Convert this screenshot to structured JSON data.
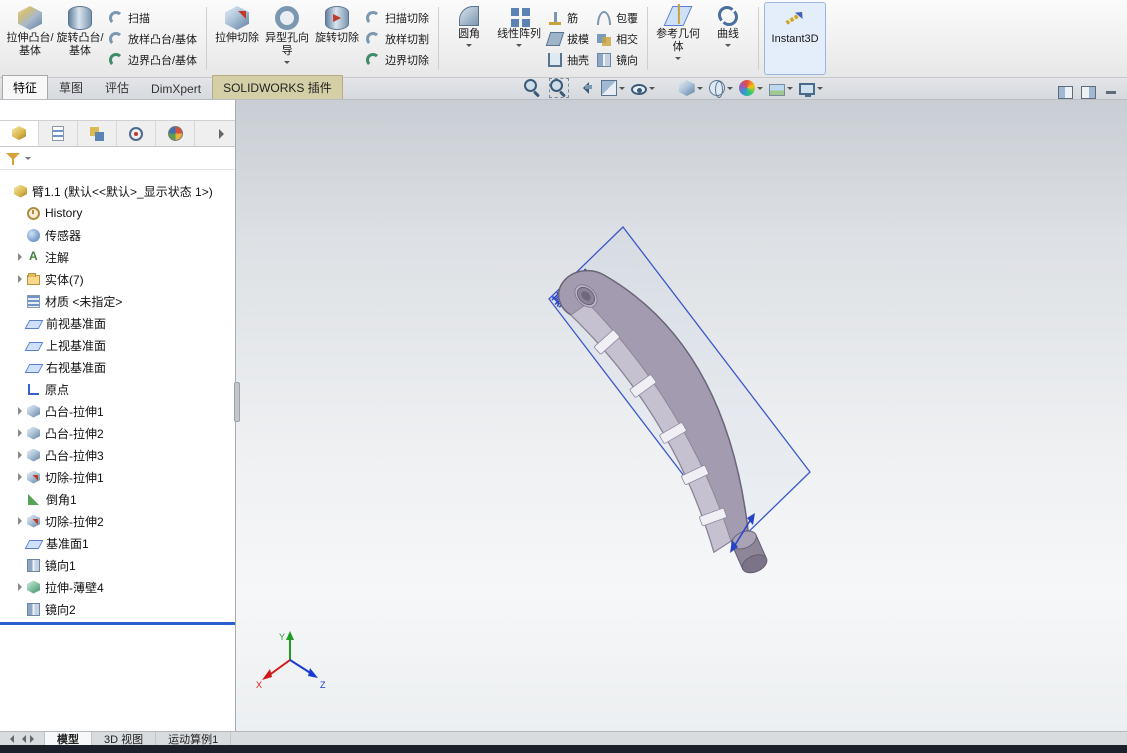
{
  "ribbon": {
    "extrude_boss": "拉伸凸台/基体",
    "revolve_boss": "旋转凸台/基体",
    "sweep": "扫描",
    "loft": "放样凸台/基体",
    "boundary": "边界凸台/基体",
    "extrude_cut": "拉伸切除",
    "hole_wizard": "异型孔向导",
    "revolve_cut": "旋转切除",
    "sweep_cut": "扫描切除",
    "loft_cut": "放样切割",
    "boundary_cut": "边界切除",
    "fillet": "圆角",
    "linear_pattern": "线性阵列",
    "rib": "筋",
    "draft": "拔模",
    "shell": "抽壳",
    "wrap": "包覆",
    "intersect": "相交",
    "mirror": "镜向",
    "reference_geometry": "参考几何体",
    "curves": "曲线",
    "instant3d": "Instant3D"
  },
  "command_tabs": {
    "features": "特征",
    "sketch": "草图",
    "evaluate": "评估",
    "dimxpert": "DimXpert",
    "addins": "SOLIDWORKS 插件"
  },
  "tree": {
    "items": [
      {
        "id": "root",
        "label": "臂1.1 (默认<<默认>_显示状态 1>)",
        "icon": "part",
        "indent": 0,
        "arrow": false
      },
      {
        "id": "history",
        "label": "History",
        "icon": "history",
        "indent": 1,
        "arrow": false
      },
      {
        "id": "sensors",
        "label": "传感器",
        "icon": "sensors",
        "indent": 1,
        "arrow": false
      },
      {
        "id": "annotations",
        "label": "注解",
        "icon": "annotations",
        "indent": 1,
        "arrow": true
      },
      {
        "id": "solid-bodies",
        "label": "实体(7)",
        "icon": "bodies",
        "indent": 1,
        "arrow": true
      },
      {
        "id": "material",
        "label": "材质 <未指定>",
        "icon": "material",
        "indent": 1,
        "arrow": false
      },
      {
        "id": "front-plane",
        "label": "前视基准面",
        "icon": "plane",
        "indent": 1,
        "arrow": false
      },
      {
        "id": "top-plane",
        "label": "上视基准面",
        "icon": "plane",
        "indent": 1,
        "arrow": false
      },
      {
        "id": "right-plane",
        "label": "右视基准面",
        "icon": "plane",
        "indent": 1,
        "arrow": false
      },
      {
        "id": "origin",
        "label": "原点",
        "icon": "origin",
        "indent": 1,
        "arrow": false
      },
      {
        "id": "boss-extrude1",
        "label": "凸台-拉伸1",
        "icon": "boss-extrude",
        "indent": 1,
        "arrow": true
      },
      {
        "id": "boss-extrude2",
        "label": "凸台-拉伸2",
        "icon": "boss-extrude",
        "indent": 1,
        "arrow": true
      },
      {
        "id": "boss-extrude3",
        "label": "凸台-拉伸3",
        "icon": "boss-extrude",
        "indent": 1,
        "arrow": true
      },
      {
        "id": "cut-extrude1",
        "label": "切除-拉伸1",
        "icon": "cut-extrude",
        "indent": 1,
        "arrow": true
      },
      {
        "id": "chamfer1",
        "label": "倒角1",
        "icon": "chamfer",
        "indent": 1,
        "arrow": false
      },
      {
        "id": "cut-extrude2",
        "label": "切除-拉伸2",
        "icon": "cut-extrude",
        "indent": 1,
        "arrow": true
      },
      {
        "id": "plane1",
        "label": "基准面1",
        "icon": "plane",
        "indent": 1,
        "arrow": false
      },
      {
        "id": "mirror1",
        "label": "镜向1",
        "icon": "mirror",
        "indent": 1,
        "arrow": false
      },
      {
        "id": "thin-extrude4",
        "label": "拉伸-薄壁4",
        "icon": "thin-extrude",
        "indent": 1,
        "arrow": true
      },
      {
        "id": "mirror2",
        "label": "镜向2",
        "icon": "mirror",
        "indent": 1,
        "arrow": false
      }
    ]
  },
  "viewport": {
    "plane_label": "基准面1",
    "triad": {
      "x": "X",
      "y": "Y",
      "z": "Z"
    }
  },
  "bottom_tabs": {
    "model": "模型",
    "views3d": "3D 视图",
    "motion": "运动算例1"
  },
  "icons": {
    "headsup": [
      "zoom-fit",
      "zoom-area",
      "previous-view",
      "section-view",
      "hide-show-items",
      "view-orientation",
      "display-style",
      "edit-appearance",
      "apply-scene",
      "view-settings"
    ],
    "manager_tabs": [
      "featuremanager",
      "propertymanager",
      "configurationmanager",
      "dimxpertmanager",
      "displaymanager"
    ]
  },
  "colors": {
    "accent_blue": "#2a5fd0",
    "plane_blue": "#2743c8",
    "model_gray": "#a39cb0",
    "addins_tab": "#d5cfa7"
  }
}
